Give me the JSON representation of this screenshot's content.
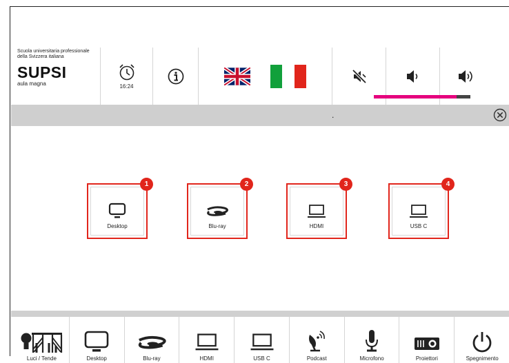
{
  "header": {
    "logo_line1": "Scuola universitaria professionale",
    "logo_line2": "della Svizzera italiana",
    "logo_brand": "SUPSI",
    "room": "aula magna",
    "clock_time": "16:24",
    "volume_level_percent": 86,
    "colors": {
      "volume_fill": "#e5007e",
      "volume_track": "#444444"
    },
    "icons": [
      "alarm-clock-icon",
      "info-icon",
      "flag-uk-icon",
      "flag-italy-icon",
      "mute-icon",
      "volume-down-icon",
      "volume-up-icon"
    ]
  },
  "titlebar": {
    "text": "."
  },
  "sources": [
    {
      "label": "Desktop",
      "badge": "1",
      "icon": "monitor-icon"
    },
    {
      "label": "Blu-ray",
      "badge": "2",
      "icon": "bluray-icon"
    },
    {
      "label": "HDMI",
      "badge": "3",
      "icon": "laptop-icon"
    },
    {
      "label": "USB C",
      "badge": "4",
      "icon": "laptop-icon"
    }
  ],
  "bottom": [
    {
      "label": "Luci / Tende",
      "icon": "lights-curtains-icon"
    },
    {
      "label": "Desktop",
      "icon": "monitor-icon"
    },
    {
      "label": "Blu-ray",
      "icon": "bluray-icon"
    },
    {
      "label": "HDMI",
      "icon": "laptop-icon"
    },
    {
      "label": "USB C",
      "icon": "laptop-icon"
    },
    {
      "label": "Podcast",
      "icon": "satellite-dish-icon"
    },
    {
      "label": "Microfono",
      "icon": "microphone-icon"
    },
    {
      "label": "Proiettori",
      "icon": "projector-icon"
    },
    {
      "label": "Spegnimento",
      "icon": "power-icon"
    }
  ],
  "colors": {
    "accent_red": "#e1251b",
    "titlebar_bg": "#cfcfcf"
  }
}
